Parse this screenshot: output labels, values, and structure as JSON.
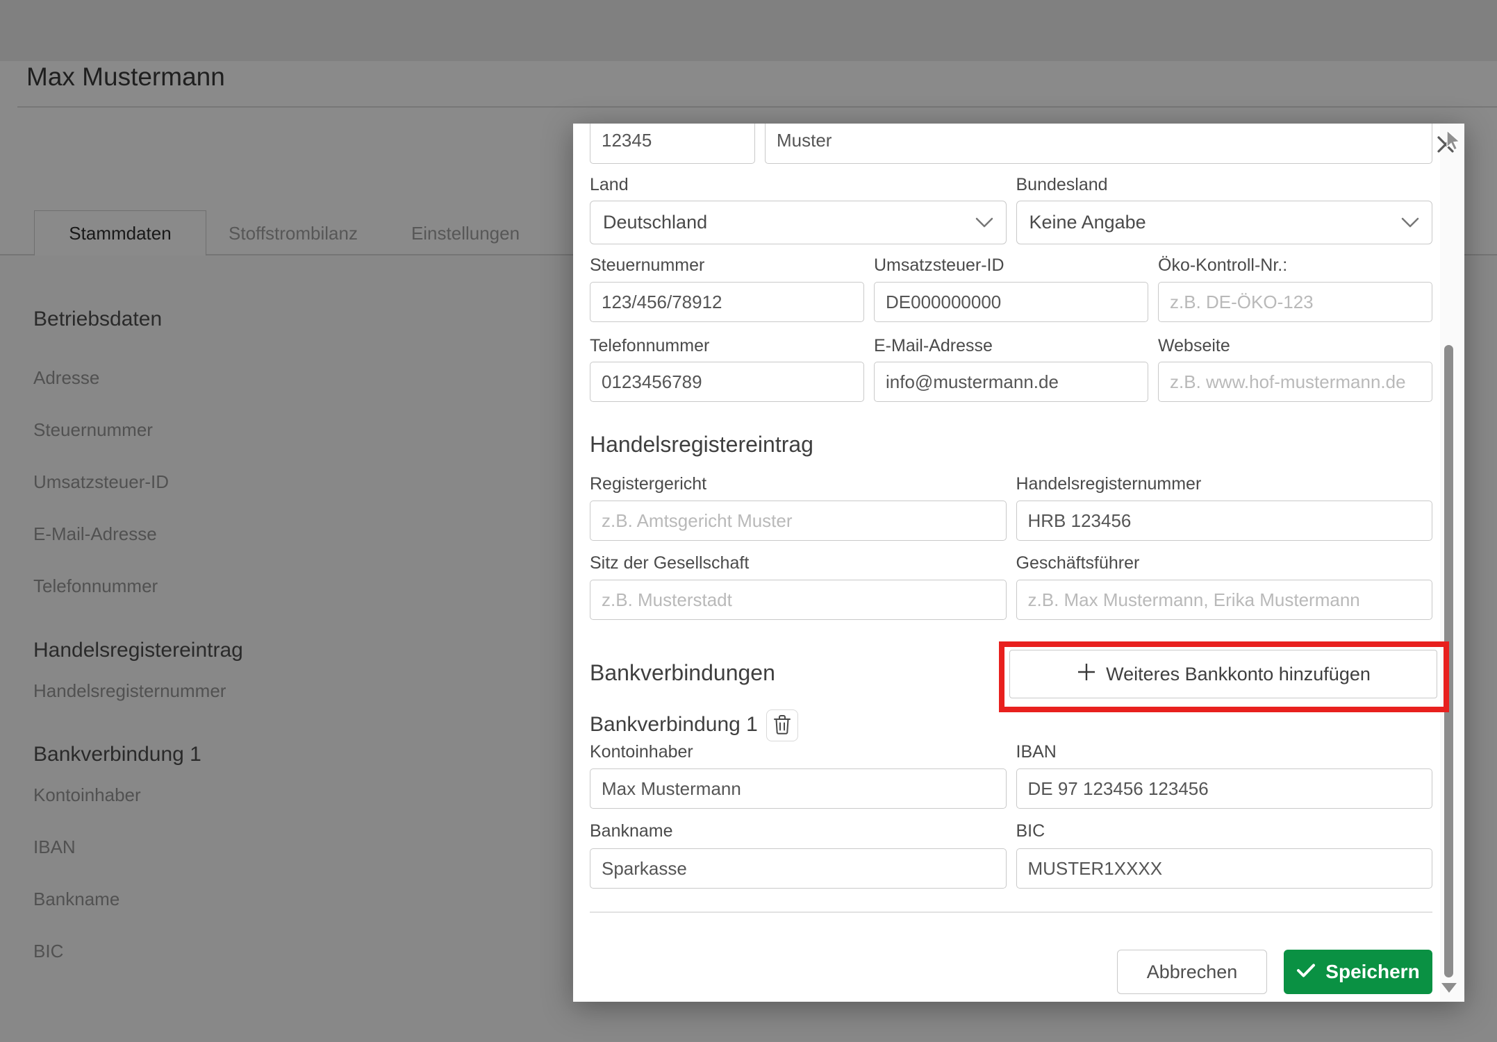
{
  "colors": {
    "accent_green": "#0a9143",
    "annotation_red": "#e8201e"
  },
  "page": {
    "title": "Max Mustermann",
    "tabs": [
      {
        "label": "Stammdaten",
        "active": true
      },
      {
        "label": "Stoffstrombilanz",
        "active": false
      },
      {
        "label": "Einstellungen",
        "active": false
      }
    ],
    "sidebar": {
      "sections": [
        {
          "heading": "Betriebsdaten",
          "items": [
            "Adresse",
            "Steuernummer",
            "Umsatzsteuer-ID",
            "E-Mail-Adresse",
            "Telefonnummer"
          ]
        },
        {
          "heading": "Handelsregistereintrag",
          "items": [
            "Handelsregisternummer"
          ]
        },
        {
          "heading": "Bankverbindung 1",
          "items": [
            "Kontoinhaber",
            "IBAN",
            "Bankname",
            "BIC"
          ]
        }
      ]
    }
  },
  "modal": {
    "zip": {
      "value": "12345"
    },
    "city": {
      "value": "Muster"
    },
    "country": {
      "label": "Land",
      "value": "Deutschland"
    },
    "state": {
      "label": "Bundesland",
      "value": "Keine Angabe"
    },
    "tax_number": {
      "label": "Steuernummer",
      "value": "123/456/78912"
    },
    "vat_id": {
      "label": "Umsatzsteuer-ID",
      "value": "DE000000000"
    },
    "eco_control": {
      "label": "Öko-Kontroll-Nr.:",
      "placeholder": "z.B. DE-ÖKO-123"
    },
    "phone": {
      "label": "Telefonnummer",
      "value": "0123456789"
    },
    "email": {
      "label": "E-Mail-Adresse",
      "value": "info@mustermann.de"
    },
    "website": {
      "label": "Webseite",
      "placeholder": "z.B. www.hof-mustermann.de"
    },
    "trade_register_heading": "Handelsregistereintrag",
    "register_court": {
      "label": "Registergericht",
      "placeholder": "z.B. Amtsgericht Muster"
    },
    "register_number": {
      "label": "Handelsregisternummer",
      "value": "HRB 123456"
    },
    "company_seat": {
      "label": "Sitz der Gesellschaft",
      "placeholder": "z.B. Musterstadt"
    },
    "managing_directors": {
      "label": "Geschäftsführer",
      "placeholder": "z.B. Max Mustermann, Erika Mustermann"
    },
    "bank_section_heading": "Bankverbindungen",
    "add_bank_label": "Weiteres Bankkonto hinzufügen",
    "bank1_heading": "Bankverbindung 1",
    "account_holder": {
      "label": "Kontoinhaber",
      "value": "Max Mustermann"
    },
    "iban": {
      "label": "IBAN",
      "value": "DE 97 123456 123456"
    },
    "bank_name": {
      "label": "Bankname",
      "value": "Sparkasse"
    },
    "bic": {
      "label": "BIC",
      "value": "MUSTER1XXXX"
    },
    "cancel_label": "Abbrechen",
    "save_label": "Speichern"
  }
}
